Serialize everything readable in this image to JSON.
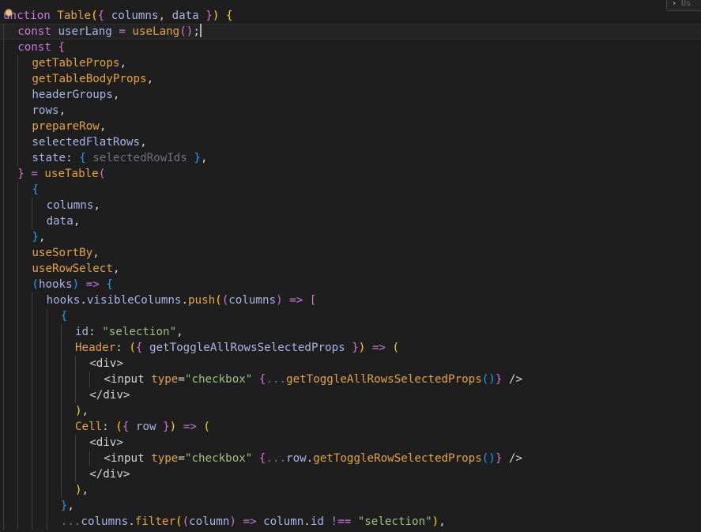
{
  "colors": {
    "background": "#1e1e1e",
    "current_line": "#232323",
    "indent_guide": "#404040",
    "default": "#d4d4d4",
    "keyword": "#c678dd",
    "function": "#e5a33b",
    "variable": "#a8b4e8",
    "property": "#e5a33b",
    "string": "#98c379",
    "bracket_yellow": "#ffd700",
    "bracket_pink": "#da70d6",
    "bracket_blue": "#179fff",
    "operator": "#c678dd",
    "tag": "#d4d4d4",
    "attribute": "#e5a33b",
    "comment_faded": "#6b7280"
  },
  "widget": {
    "chevron": "›",
    "text": "Us"
  },
  "editor": {
    "current_line_index": 1,
    "lines": [
      {
        "indent": 0,
        "tokens": [
          {
            "t": "unction",
            "c": "keyword"
          },
          {
            "t": " ",
            "c": "default"
          },
          {
            "t": "Table",
            "c": "function"
          },
          {
            "t": "(",
            "c": "bracket_yellow"
          },
          {
            "t": "{",
            "c": "bracket_pink"
          },
          {
            "t": " columns",
            "c": "variable"
          },
          {
            "t": ", ",
            "c": "default"
          },
          {
            "t": "data",
            "c": "variable"
          },
          {
            "t": " }",
            "c": "bracket_pink"
          },
          {
            "t": ")",
            "c": "bracket_yellow"
          },
          {
            "t": " ",
            "c": "default"
          },
          {
            "t": "{",
            "c": "bracket_yellow"
          }
        ]
      },
      {
        "indent": 1,
        "tokens": [
          {
            "t": "const",
            "c": "keyword"
          },
          {
            "t": " userLang ",
            "c": "variable"
          },
          {
            "t": "=",
            "c": "operator"
          },
          {
            "t": " ",
            "c": "default"
          },
          {
            "t": "useLang",
            "c": "function"
          },
          {
            "t": "()",
            "c": "bracket_pink"
          },
          {
            "t": ";",
            "c": "default"
          }
        ],
        "caret": true
      },
      {
        "indent": 1,
        "tokens": [
          {
            "t": "const",
            "c": "keyword"
          },
          {
            "t": " ",
            "c": "default"
          },
          {
            "t": "{",
            "c": "bracket_pink"
          }
        ]
      },
      {
        "indent": 2,
        "tokens": [
          {
            "t": "getTableProps",
            "c": "property"
          },
          {
            "t": ",",
            "c": "default"
          }
        ]
      },
      {
        "indent": 2,
        "tokens": [
          {
            "t": "getTableBodyProps",
            "c": "property"
          },
          {
            "t": ",",
            "c": "default"
          }
        ]
      },
      {
        "indent": 2,
        "tokens": [
          {
            "t": "headerGroups",
            "c": "variable"
          },
          {
            "t": ",",
            "c": "default"
          }
        ]
      },
      {
        "indent": 2,
        "tokens": [
          {
            "t": "rows",
            "c": "variable"
          },
          {
            "t": ",",
            "c": "default"
          }
        ]
      },
      {
        "indent": 2,
        "tokens": [
          {
            "t": "prepareRow",
            "c": "property"
          },
          {
            "t": ",",
            "c": "default"
          }
        ]
      },
      {
        "indent": 2,
        "tokens": [
          {
            "t": "selectedFlatRows",
            "c": "variable"
          },
          {
            "t": ",",
            "c": "default"
          }
        ]
      },
      {
        "indent": 2,
        "tokens": [
          {
            "t": "state",
            "c": "variable"
          },
          {
            "t": ": ",
            "c": "default"
          },
          {
            "t": "{",
            "c": "bracket_blue"
          },
          {
            "t": " selectedRowIds ",
            "c": "comment_faded"
          },
          {
            "t": "}",
            "c": "bracket_blue"
          },
          {
            "t": ",",
            "c": "default"
          }
        ]
      },
      {
        "indent": 1,
        "tokens": [
          {
            "t": "}",
            "c": "bracket_pink"
          },
          {
            "t": " ",
            "c": "default"
          },
          {
            "t": "=",
            "c": "operator"
          },
          {
            "t": " ",
            "c": "default"
          },
          {
            "t": "useTable",
            "c": "function"
          },
          {
            "t": "(",
            "c": "bracket_pink"
          }
        ]
      },
      {
        "indent": 2,
        "tokens": [
          {
            "t": "{",
            "c": "bracket_blue"
          }
        ]
      },
      {
        "indent": 3,
        "tokens": [
          {
            "t": "columns",
            "c": "variable"
          },
          {
            "t": ",",
            "c": "default"
          }
        ]
      },
      {
        "indent": 3,
        "tokens": [
          {
            "t": "data",
            "c": "variable"
          },
          {
            "t": ",",
            "c": "default"
          }
        ]
      },
      {
        "indent": 2,
        "tokens": [
          {
            "t": "}",
            "c": "bracket_blue"
          },
          {
            "t": ",",
            "c": "default"
          }
        ]
      },
      {
        "indent": 2,
        "tokens": [
          {
            "t": "useSortBy",
            "c": "property"
          },
          {
            "t": ",",
            "c": "default"
          }
        ]
      },
      {
        "indent": 2,
        "tokens": [
          {
            "t": "useRowSelect",
            "c": "property"
          },
          {
            "t": ",",
            "c": "default"
          }
        ]
      },
      {
        "indent": 2,
        "tokens": [
          {
            "t": "(",
            "c": "bracket_blue"
          },
          {
            "t": "hooks",
            "c": "variable"
          },
          {
            "t": ")",
            "c": "bracket_blue"
          },
          {
            "t": " ",
            "c": "default"
          },
          {
            "t": "=>",
            "c": "operator"
          },
          {
            "t": " ",
            "c": "default"
          },
          {
            "t": "{",
            "c": "bracket_blue"
          }
        ]
      },
      {
        "indent": 3,
        "tokens": [
          {
            "t": "hooks",
            "c": "variable"
          },
          {
            "t": ".",
            "c": "default"
          },
          {
            "t": "visibleColumns",
            "c": "variable"
          },
          {
            "t": ".",
            "c": "default"
          },
          {
            "t": "push",
            "c": "function"
          },
          {
            "t": "(",
            "c": "bracket_yellow"
          },
          {
            "t": "(",
            "c": "bracket_pink"
          },
          {
            "t": "columns",
            "c": "variable"
          },
          {
            "t": ")",
            "c": "bracket_pink"
          },
          {
            "t": " ",
            "c": "default"
          },
          {
            "t": "=>",
            "c": "operator"
          },
          {
            "t": " ",
            "c": "default"
          },
          {
            "t": "[",
            "c": "bracket_pink"
          }
        ]
      },
      {
        "indent": 4,
        "tokens": [
          {
            "t": "{",
            "c": "bracket_blue"
          }
        ]
      },
      {
        "indent": 5,
        "tokens": [
          {
            "t": "id",
            "c": "variable"
          },
          {
            "t": ": ",
            "c": "default"
          },
          {
            "t": "\"selection\"",
            "c": "string"
          },
          {
            "t": ",",
            "c": "default"
          }
        ]
      },
      {
        "indent": 5,
        "tokens": [
          {
            "t": "Header",
            "c": "property"
          },
          {
            "t": ": ",
            "c": "default"
          },
          {
            "t": "(",
            "c": "bracket_yellow"
          },
          {
            "t": "{",
            "c": "bracket_pink"
          },
          {
            "t": " getToggleAllRowsSelectedProps ",
            "c": "variable"
          },
          {
            "t": "}",
            "c": "bracket_pink"
          },
          {
            "t": ")",
            "c": "bracket_yellow"
          },
          {
            "t": " ",
            "c": "default"
          },
          {
            "t": "=>",
            "c": "operator"
          },
          {
            "t": " ",
            "c": "default"
          },
          {
            "t": "(",
            "c": "bracket_yellow"
          }
        ]
      },
      {
        "indent": 6,
        "tokens": [
          {
            "t": "<div>",
            "c": "tag"
          }
        ]
      },
      {
        "indent": 7,
        "tokens": [
          {
            "t": "<input",
            "c": "tag"
          },
          {
            "t": " ",
            "c": "default"
          },
          {
            "t": "type",
            "c": "attribute"
          },
          {
            "t": "=",
            "c": "default"
          },
          {
            "t": "\"checkbox\"",
            "c": "string"
          },
          {
            "t": " ",
            "c": "default"
          },
          {
            "t": "{",
            "c": "bracket_pink"
          },
          {
            "t": "...",
            "c": "comment_faded"
          },
          {
            "t": "getToggleAllRowsSelectedProps",
            "c": "function"
          },
          {
            "t": "()",
            "c": "bracket_blue"
          },
          {
            "t": "}",
            "c": "bracket_pink"
          },
          {
            "t": " />",
            "c": "tag"
          }
        ]
      },
      {
        "indent": 6,
        "tokens": [
          {
            "t": "</div>",
            "c": "tag"
          }
        ]
      },
      {
        "indent": 5,
        "tokens": [
          {
            "t": ")",
            "c": "bracket_yellow"
          },
          {
            "t": ",",
            "c": "default"
          }
        ]
      },
      {
        "indent": 5,
        "tokens": [
          {
            "t": "Cell",
            "c": "property"
          },
          {
            "t": ": ",
            "c": "default"
          },
          {
            "t": "(",
            "c": "bracket_yellow"
          },
          {
            "t": "{",
            "c": "bracket_pink"
          },
          {
            "t": " row ",
            "c": "variable"
          },
          {
            "t": "}",
            "c": "bracket_pink"
          },
          {
            "t": ")",
            "c": "bracket_yellow"
          },
          {
            "t": " ",
            "c": "default"
          },
          {
            "t": "=>",
            "c": "operator"
          },
          {
            "t": " ",
            "c": "default"
          },
          {
            "t": "(",
            "c": "bracket_yellow"
          }
        ]
      },
      {
        "indent": 6,
        "tokens": [
          {
            "t": "<div>",
            "c": "tag"
          }
        ]
      },
      {
        "indent": 7,
        "tokens": [
          {
            "t": "<input",
            "c": "tag"
          },
          {
            "t": " ",
            "c": "default"
          },
          {
            "t": "type",
            "c": "attribute"
          },
          {
            "t": "=",
            "c": "default"
          },
          {
            "t": "\"checkbox\"",
            "c": "string"
          },
          {
            "t": " ",
            "c": "default"
          },
          {
            "t": "{",
            "c": "bracket_pink"
          },
          {
            "t": "...",
            "c": "comment_faded"
          },
          {
            "t": "row",
            "c": "variable"
          },
          {
            "t": ".",
            "c": "default"
          },
          {
            "t": "getToggleRowSelectedProps",
            "c": "function"
          },
          {
            "t": "()",
            "c": "bracket_blue"
          },
          {
            "t": "}",
            "c": "bracket_pink"
          },
          {
            "t": " />",
            "c": "tag"
          }
        ]
      },
      {
        "indent": 6,
        "tokens": [
          {
            "t": "</div>",
            "c": "tag"
          }
        ]
      },
      {
        "indent": 5,
        "tokens": [
          {
            "t": ")",
            "c": "bracket_yellow"
          },
          {
            "t": ",",
            "c": "default"
          }
        ]
      },
      {
        "indent": 4,
        "tokens": [
          {
            "t": "}",
            "c": "bracket_blue"
          },
          {
            "t": ",",
            "c": "default"
          }
        ]
      },
      {
        "indent": 4,
        "tokens": [
          {
            "t": "...",
            "c": "comment_faded"
          },
          {
            "t": "columns",
            "c": "variable"
          },
          {
            "t": ".",
            "c": "default"
          },
          {
            "t": "filter",
            "c": "function"
          },
          {
            "t": "(",
            "c": "bracket_yellow"
          },
          {
            "t": "(",
            "c": "bracket_pink"
          },
          {
            "t": "column",
            "c": "variable"
          },
          {
            "t": ")",
            "c": "bracket_pink"
          },
          {
            "t": " ",
            "c": "default"
          },
          {
            "t": "=>",
            "c": "operator"
          },
          {
            "t": " ",
            "c": "default"
          },
          {
            "t": "column",
            "c": "variable"
          },
          {
            "t": ".",
            "c": "default"
          },
          {
            "t": "id",
            "c": "variable"
          },
          {
            "t": " ",
            "c": "default"
          },
          {
            "t": "!==",
            "c": "operator"
          },
          {
            "t": " ",
            "c": "default"
          },
          {
            "t": "\"selection\"",
            "c": "string"
          },
          {
            "t": ")",
            "c": "bracket_yellow"
          },
          {
            "t": ",",
            "c": "default"
          }
        ]
      }
    ]
  }
}
